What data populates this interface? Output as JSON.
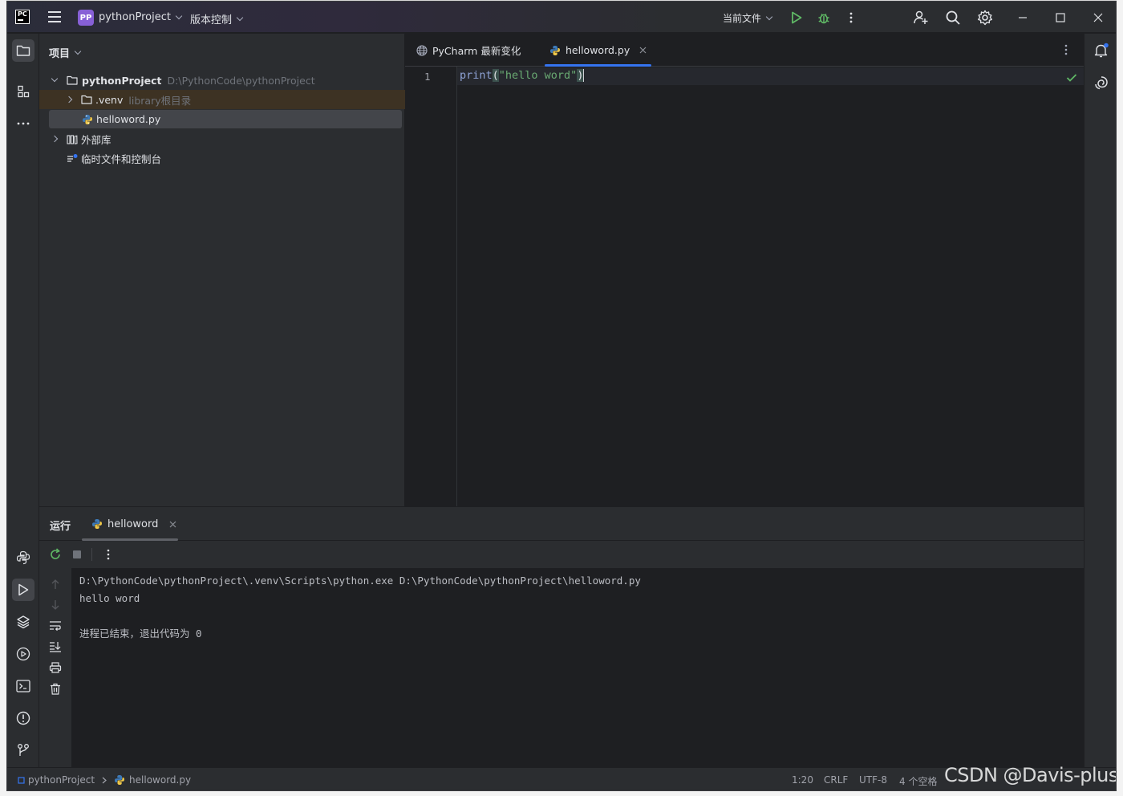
{
  "titlebar": {
    "logo_text": "PC",
    "project_badge": "PP",
    "project_name": "pythonProject",
    "vcs_label": "版本控制",
    "run_config": "当前文件"
  },
  "project_panel": {
    "title": "项目",
    "tree": [
      {
        "label": "pythonProject",
        "hint": "D:\\PythonCode\\pythonProject",
        "kind": "folder",
        "expanded": true
      },
      {
        "label": ".venv",
        "hint": "library根目录",
        "kind": "folder",
        "expanded": false
      },
      {
        "label": "helloword.py",
        "hint": "",
        "kind": "python-file",
        "selected": true
      },
      {
        "label": "外部库",
        "hint": "",
        "kind": "library",
        "expanded": false
      },
      {
        "label": "临时文件和控制台",
        "hint": "",
        "kind": "scratches"
      }
    ]
  },
  "editor": {
    "tabs": [
      {
        "label": "PyCharm 最新变化",
        "active": false
      },
      {
        "label": "helloword.py",
        "active": true
      }
    ],
    "line_number": "1",
    "code": {
      "func": "print",
      "open": "(",
      "string": "\"hello word\"",
      "close": ")"
    }
  },
  "run_panel": {
    "title": "运行",
    "tab_label": "helloword",
    "console": [
      "D:\\PythonCode\\pythonProject\\.venv\\Scripts\\python.exe D:\\PythonCode\\pythonProject\\helloword.py",
      "hello word",
      "",
      "进程已结束，退出代码为 0"
    ]
  },
  "statusbar": {
    "breadcrumb_project": "pythonProject",
    "breadcrumb_file": "helloword.py",
    "position": "1:20",
    "line_ending": "CRLF",
    "encoding": "UTF-8",
    "indent": "4 个空格"
  },
  "watermark": "CSDN @Davis-plus",
  "colors": {
    "accent": "#3574f0",
    "run_green": "#5fb865",
    "project_badge": "#8760d6",
    "keyword_func": "#8fa3d6",
    "string": "#6aab73"
  }
}
